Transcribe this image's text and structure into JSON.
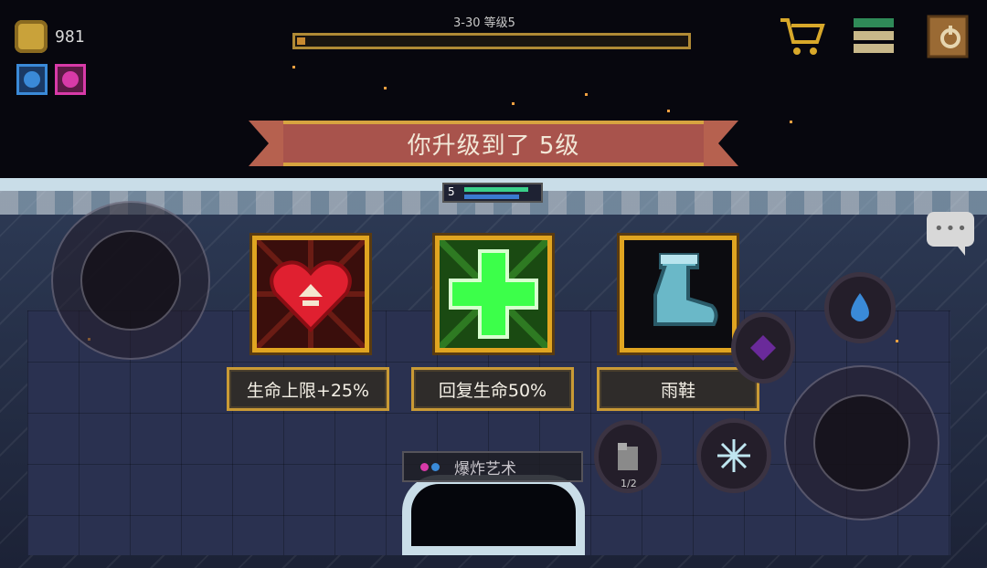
{
  "hud": {
    "coins": "981",
    "stage_level": "3-30  等级5",
    "xp_progress": 0.02,
    "player_level": "5",
    "ammo_count": "1/2"
  },
  "banner": {
    "text": "你升级到了 5级"
  },
  "choices": [
    {
      "label": "生命上限+25%",
      "icon": "heart-up-icon"
    },
    {
      "label": "回复生命50%",
      "icon": "green-cross-icon"
    },
    {
      "label": "雨鞋",
      "icon": "rain-boot-icon"
    }
  ],
  "weapon": {
    "name": "爆炸艺术"
  },
  "colors": {
    "accent": "#e0a521",
    "banner": "#a8534c",
    "heal": "#3cff4a",
    "heart": "#e02030"
  }
}
